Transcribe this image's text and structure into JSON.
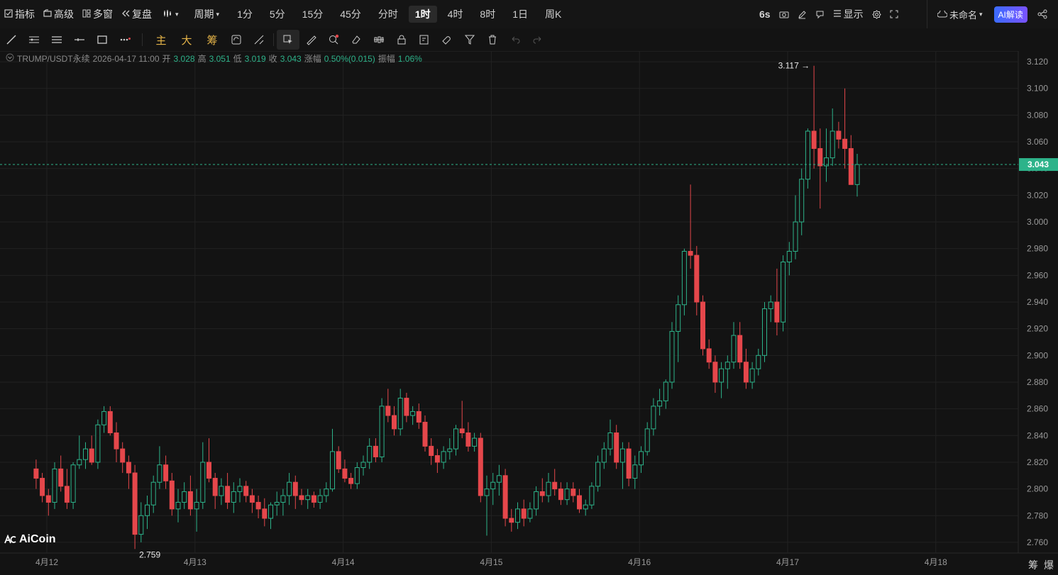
{
  "topbar": {
    "indicator": "指标",
    "advanced": "高级",
    "multi_window": "多窗",
    "replay": "复盘",
    "period": "周期",
    "periods": [
      "1分",
      "5分",
      "15分",
      "45分",
      "分时",
      "1时",
      "4时",
      "8时",
      "1日",
      "周K"
    ],
    "active_period": "1时",
    "refresh": "6s",
    "display": "显示",
    "layout_name": "未命名",
    "ai_button": "AI解读"
  },
  "toolbar": {
    "cn_tools": [
      "主",
      "大",
      "筹"
    ]
  },
  "info": {
    "symbol": "TRUMP/USDT永续",
    "datetime": "2026-04-17 11:00",
    "open_label": "开",
    "open": "3.028",
    "high_label": "高",
    "high": "3.051",
    "low_label": "低",
    "low": "3.019",
    "close_label": "收",
    "close": "3.043",
    "change_label": "涨幅",
    "change": "0.50%(0.015)",
    "amp_label": "振幅",
    "amp": "1.06%"
  },
  "logo": "AiCoin",
  "bottom_right": [
    "筹",
    "爆"
  ],
  "colors": {
    "up": "#2db38a",
    "down": "#e5474b",
    "bg": "#131313",
    "grid": "#222222"
  },
  "chart_data": {
    "type": "candlestick",
    "y_ticks": [
      "3.120",
      "3.100",
      "3.080",
      "3.060",
      "3.040",
      "3.020",
      "3.000",
      "2.980",
      "2.960",
      "2.940",
      "2.920",
      "2.900",
      "2.880",
      "2.860",
      "2.840",
      "2.820",
      "2.800",
      "2.780",
      "2.760"
    ],
    "ylim": [
      2.752,
      3.128
    ],
    "x_labels": [
      "4月12",
      "4月13",
      "4月14",
      "4月15",
      "4月16",
      "4月17",
      "4月18"
    ],
    "current_price": "3.043",
    "high_marker": "3.117",
    "low_marker": "2.759",
    "ohlc": [
      [
        2.815,
        2.822,
        2.8,
        2.808
      ],
      [
        2.808,
        2.812,
        2.79,
        2.795
      ],
      [
        2.795,
        2.8,
        2.78,
        2.79
      ],
      [
        2.79,
        2.82,
        2.785,
        2.815
      ],
      [
        2.815,
        2.825,
        2.798,
        2.802
      ],
      [
        2.802,
        2.815,
        2.785,
        2.79
      ],
      [
        2.79,
        2.82,
        2.785,
        2.818
      ],
      [
        2.818,
        2.84,
        2.815,
        2.822
      ],
      [
        2.822,
        2.835,
        2.815,
        2.83
      ],
      [
        2.83,
        2.84,
        2.818,
        2.82
      ],
      [
        2.82,
        2.852,
        2.815,
        2.848
      ],
      [
        2.848,
        2.862,
        2.842,
        2.858
      ],
      [
        2.858,
        2.862,
        2.84,
        2.842
      ],
      [
        2.842,
        2.85,
        2.82,
        2.83
      ],
      [
        2.83,
        2.835,
        2.812,
        2.82
      ],
      [
        2.82,
        2.825,
        2.8,
        2.812
      ],
      [
        2.812,
        2.818,
        2.755,
        2.766
      ],
      [
        2.766,
        2.79,
        2.76,
        2.78
      ],
      [
        2.78,
        2.795,
        2.77,
        2.788
      ],
      [
        2.788,
        2.81,
        2.782,
        2.805
      ],
      [
        2.805,
        2.832,
        2.8,
        2.818
      ],
      [
        2.818,
        2.825,
        2.8,
        2.806
      ],
      [
        2.806,
        2.812,
        2.78,
        2.785
      ],
      [
        2.785,
        2.8,
        2.775,
        2.79
      ],
      [
        2.79,
        2.805,
        2.785,
        2.798
      ],
      [
        2.798,
        2.81,
        2.78,
        2.785
      ],
      [
        2.785,
        2.8,
        2.768,
        2.79
      ],
      [
        2.79,
        2.835,
        2.785,
        2.82
      ],
      [
        2.82,
        2.838,
        2.805,
        2.808
      ],
      [
        2.808,
        2.812,
        2.785,
        2.795
      ],
      [
        2.795,
        2.808,
        2.788,
        2.802
      ],
      [
        2.802,
        2.812,
        2.785,
        2.79
      ],
      [
        2.79,
        2.805,
        2.782,
        2.798
      ],
      [
        2.798,
        2.808,
        2.79,
        2.802
      ],
      [
        2.802,
        2.806,
        2.79,
        2.795
      ],
      [
        2.795,
        2.8,
        2.782,
        2.79
      ],
      [
        2.79,
        2.795,
        2.778,
        2.785
      ],
      [
        2.785,
        2.793,
        2.772,
        2.778
      ],
      [
        2.778,
        2.79,
        2.77,
        2.788
      ],
      [
        2.788,
        2.798,
        2.78,
        2.79
      ],
      [
        2.79,
        2.8,
        2.78,
        2.795
      ],
      [
        2.795,
        2.812,
        2.788,
        2.805
      ],
      [
        2.805,
        2.81,
        2.785,
        2.795
      ],
      [
        2.795,
        2.8,
        2.788,
        2.792
      ],
      [
        2.792,
        2.8,
        2.785,
        2.795
      ],
      [
        2.795,
        2.798,
        2.786,
        2.79
      ],
      [
        2.79,
        2.8,
        2.785,
        2.795
      ],
      [
        2.795,
        2.805,
        2.79,
        2.8
      ],
      [
        2.8,
        2.845,
        2.798,
        2.828
      ],
      [
        2.828,
        2.832,
        2.812,
        2.815
      ],
      [
        2.815,
        2.822,
        2.805,
        2.808
      ],
      [
        2.808,
        2.812,
        2.8,
        2.804
      ],
      [
        2.804,
        2.82,
        2.8,
        2.816
      ],
      [
        2.816,
        2.825,
        2.81,
        2.82
      ],
      [
        2.82,
        2.838,
        2.815,
        2.832
      ],
      [
        2.832,
        2.838,
        2.82,
        2.824
      ],
      [
        2.824,
        2.868,
        2.82,
        2.862
      ],
      [
        2.862,
        2.875,
        2.85,
        2.855
      ],
      [
        2.855,
        2.862,
        2.84,
        2.845
      ],
      [
        2.845,
        2.875,
        2.84,
        2.868
      ],
      [
        2.868,
        2.872,
        2.85,
        2.855
      ],
      [
        2.855,
        2.862,
        2.848,
        2.858
      ],
      [
        2.858,
        2.864,
        2.845,
        2.85
      ],
      [
        2.85,
        2.855,
        2.828,
        2.832
      ],
      [
        2.832,
        2.838,
        2.818,
        2.825
      ],
      [
        2.825,
        2.83,
        2.812,
        2.82
      ],
      [
        2.82,
        2.832,
        2.815,
        2.828
      ],
      [
        2.828,
        2.838,
        2.822,
        2.83
      ],
      [
        2.83,
        2.848,
        2.825,
        2.845
      ],
      [
        2.845,
        2.866,
        2.838,
        2.842
      ],
      [
        2.842,
        2.85,
        2.828,
        2.832
      ],
      [
        2.832,
        2.842,
        2.828,
        2.838
      ],
      [
        2.838,
        2.842,
        2.79,
        2.795
      ],
      [
        2.795,
        2.81,
        2.765,
        2.8
      ],
      [
        2.8,
        2.812,
        2.788,
        2.805
      ],
      [
        2.805,
        2.818,
        2.795,
        2.81
      ],
      [
        2.81,
        2.815,
        2.772,
        2.778
      ],
      [
        2.778,
        2.785,
        2.768,
        2.775
      ],
      [
        2.775,
        2.79,
        2.77,
        2.785
      ],
      [
        2.785,
        2.792,
        2.772,
        2.778
      ],
      [
        2.778,
        2.79,
        2.775,
        2.785
      ],
      [
        2.785,
        2.802,
        2.78,
        2.798
      ],
      [
        2.798,
        2.808,
        2.79,
        2.795
      ],
      [
        2.795,
        2.812,
        2.79,
        2.805
      ],
      [
        2.805,
        2.815,
        2.795,
        2.8
      ],
      [
        2.8,
        2.805,
        2.788,
        2.792
      ],
      [
        2.792,
        2.805,
        2.788,
        2.8
      ],
      [
        2.8,
        2.805,
        2.79,
        2.795
      ],
      [
        2.795,
        2.8,
        2.782,
        2.785
      ],
      [
        2.785,
        2.792,
        2.78,
        2.788
      ],
      [
        2.788,
        2.805,
        2.785,
        2.802
      ],
      [
        2.802,
        2.825,
        2.798,
        2.82
      ],
      [
        2.82,
        2.835,
        2.815,
        2.83
      ],
      [
        2.83,
        2.852,
        2.825,
        2.842
      ],
      [
        2.842,
        2.848,
        2.815,
        2.82
      ],
      [
        2.82,
        2.835,
        2.8,
        2.83
      ],
      [
        2.83,
        2.835,
        2.802,
        2.808
      ],
      [
        2.808,
        2.825,
        2.8,
        2.818
      ],
      [
        2.818,
        2.832,
        2.812,
        2.828
      ],
      [
        2.828,
        2.85,
        2.825,
        2.845
      ],
      [
        2.845,
        2.868,
        2.84,
        2.862
      ],
      [
        2.862,
        2.875,
        2.855,
        2.866
      ],
      [
        2.866,
        2.882,
        2.86,
        2.88
      ],
      [
        2.88,
        2.925,
        2.875,
        2.918
      ],
      [
        2.918,
        2.945,
        2.895,
        2.938
      ],
      [
        2.938,
        2.98,
        2.93,
        2.978
      ],
      [
        2.978,
        3.028,
        2.965,
        2.975
      ],
      [
        2.975,
        2.982,
        2.93,
        2.94
      ],
      [
        2.94,
        2.945,
        2.9,
        2.905
      ],
      [
        2.905,
        2.912,
        2.89,
        2.895
      ],
      [
        2.895,
        2.9,
        2.872,
        2.88
      ],
      [
        2.88,
        2.895,
        2.868,
        2.89
      ],
      [
        2.89,
        2.9,
        2.875,
        2.895
      ],
      [
        2.895,
        2.925,
        2.89,
        2.915
      ],
      [
        2.915,
        2.925,
        2.89,
        2.895
      ],
      [
        2.895,
        2.905,
        2.875,
        2.88
      ],
      [
        2.88,
        2.895,
        2.875,
        2.89
      ],
      [
        2.89,
        2.905,
        2.885,
        2.9
      ],
      [
        2.9,
        2.94,
        2.895,
        2.935
      ],
      [
        2.935,
        2.945,
        2.925,
        2.94
      ],
      [
        2.94,
        2.965,
        2.915,
        2.925
      ],
      [
        2.925,
        2.975,
        2.918,
        2.97
      ],
      [
        2.97,
        2.985,
        2.96,
        2.978
      ],
      [
        2.978,
        3.02,
        2.972,
        3.0
      ],
      [
        3.0,
        3.04,
        2.99,
        3.032
      ],
      [
        3.032,
        3.07,
        3.025,
        3.068
      ],
      [
        3.068,
        3.117,
        3.04,
        3.055
      ],
      [
        3.055,
        3.07,
        3.01,
        3.042
      ],
      [
        3.042,
        3.07,
        3.03,
        3.048
      ],
      [
        3.048,
        3.085,
        3.042,
        3.068
      ],
      [
        3.068,
        3.075,
        3.055,
        3.062
      ],
      [
        3.062,
        3.1,
        3.04,
        3.055
      ],
      [
        3.055,
        3.065,
        3.028,
        3.028
      ],
      [
        3.028,
        3.051,
        3.019,
        3.043
      ]
    ]
  }
}
